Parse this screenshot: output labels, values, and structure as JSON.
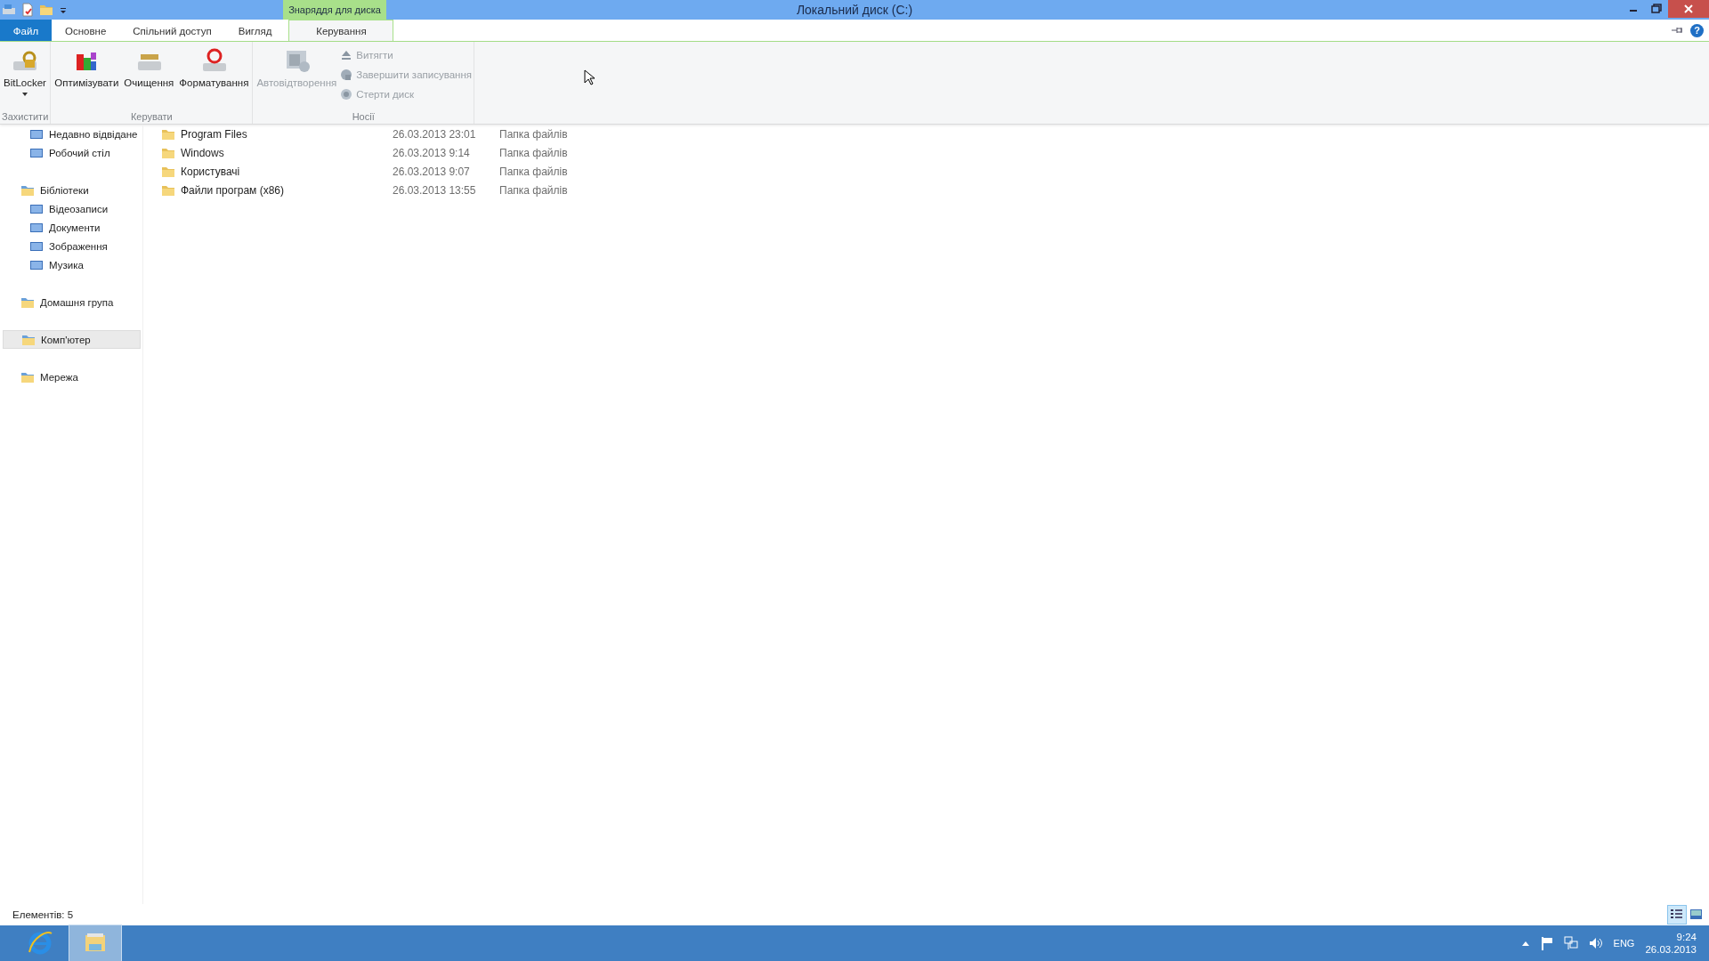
{
  "window": {
    "title": "Локальний диск (C:)",
    "context_group": "Знаряддя для диска",
    "help": "?"
  },
  "tabs": [
    {
      "label": "Файл",
      "kind": "file",
      "selected": false
    },
    {
      "label": "Основне",
      "kind": "normal",
      "selected": false
    },
    {
      "label": "Спільний доступ",
      "kind": "normal",
      "selected": false
    },
    {
      "label": "Вигляд",
      "kind": "normal",
      "selected": false
    },
    {
      "label": "Керування",
      "kind": "contextual",
      "selected": true
    }
  ],
  "ribbon": {
    "groups": [
      {
        "label": "Захистити",
        "buttons": [
          {
            "label": "BitLocker",
            "kind": "large",
            "dropdown": true,
            "disabled": false
          }
        ]
      },
      {
        "label": "Керувати",
        "buttons": [
          {
            "label": "Оптимізувати",
            "kind": "large",
            "disabled": false
          },
          {
            "label": "Очищення",
            "kind": "large",
            "disabled": false
          },
          {
            "label": "Форматування",
            "kind": "large",
            "disabled": false
          }
        ]
      },
      {
        "label": "Носії",
        "buttons": [
          {
            "label": "Автовідтворення",
            "kind": "large",
            "disabled": true
          },
          {
            "label": "Витягти",
            "kind": "small",
            "disabled": true
          },
          {
            "label": "Завершити записування",
            "kind": "small",
            "disabled": true
          },
          {
            "label": "Стерти диск",
            "kind": "small",
            "disabled": true
          }
        ]
      }
    ]
  },
  "sidebar": {
    "sections": [
      {
        "children": [
          {
            "label": "Недавно відвідане",
            "selected": false
          },
          {
            "label": "Робочий стіл",
            "selected": false
          }
        ]
      },
      {
        "label": "Бібліотеки",
        "selected": false,
        "children": [
          {
            "label": "Відеозаписи",
            "selected": false
          },
          {
            "label": "Документи",
            "selected": false
          },
          {
            "label": "Зображення",
            "selected": false
          },
          {
            "label": "Музика",
            "selected": false
          }
        ]
      },
      {
        "label": "Домашня група",
        "selected": false
      },
      {
        "label": "Комп'ютер",
        "selected": true
      },
      {
        "label": "Мережа",
        "selected": false
      }
    ]
  },
  "files": [
    {
      "name": "Program Files",
      "date": "26.03.2013 23:01",
      "type": "Папка файлів"
    },
    {
      "name": "Windows",
      "date": "26.03.2013 9:14",
      "type": "Папка файлів"
    },
    {
      "name": "Користувачі",
      "date": "26.03.2013 9:07",
      "type": "Папка файлів"
    },
    {
      "name": "Файли програм (x86)",
      "date": "26.03.2013 13:55",
      "type": "Папка файлів"
    }
  ],
  "status_bar": {
    "text": "Елементів: 5",
    "views": [
      {
        "kind": "details",
        "selected": true
      },
      {
        "kind": "large_icons",
        "selected": false
      }
    ]
  },
  "taskbar": {
    "apps": [
      {
        "kind": "browser",
        "active": false
      },
      {
        "kind": "explorer",
        "active": true
      }
    ],
    "language": "ENG",
    "time": "9:24",
    "date": "26.03.2013"
  }
}
